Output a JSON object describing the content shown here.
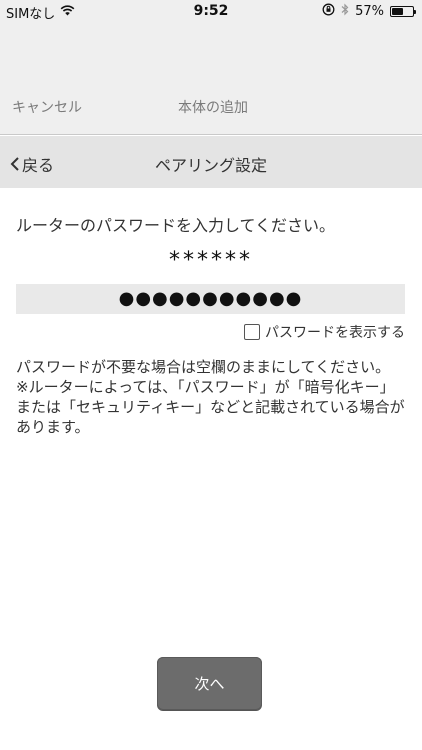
{
  "status_bar": {
    "carrier": "SIMなし",
    "time": "9:52",
    "battery_text": "57%",
    "battery_level": 0.57
  },
  "header": {
    "cancel_label": "キャンセル",
    "title": "本体の追加"
  },
  "nav": {
    "back_label": "戻る",
    "title": "ペアリング設定"
  },
  "form": {
    "instruction": "ルーターのパスワードを入力してください。",
    "ssid": "******",
    "password_value": "●●●●●●●●●●●",
    "show_password_label": "パスワードを表示する",
    "show_password_checked": false
  },
  "note": {
    "line1": "パスワードが不要な場合は空欄のままにしてください。",
    "line2": "※ルーターによっては、「パスワード」が「暗号化キー」または「セキュリティキー」などと記載されている場合があります。"
  },
  "actions": {
    "next_label": "次へ"
  },
  "colors": {
    "header_bg": "#efefef",
    "nav_bg": "#e4e4e4",
    "button_bg": "#6c6c6c"
  }
}
